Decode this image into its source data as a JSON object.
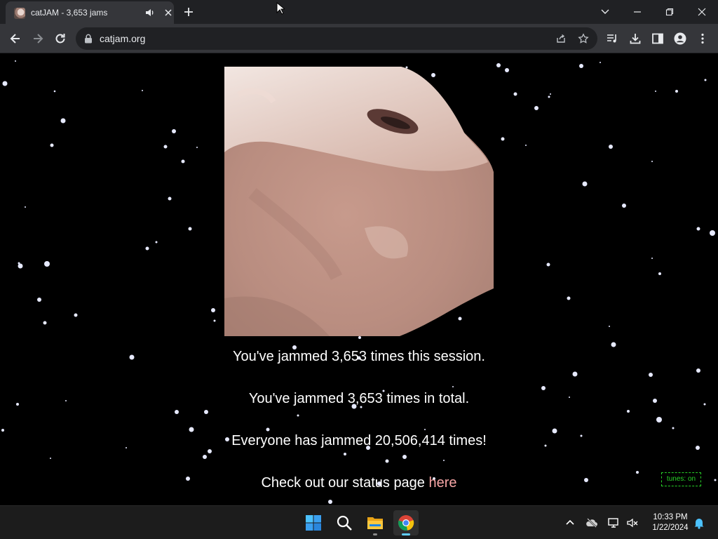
{
  "browser": {
    "tab": {
      "title": "catJAM - 3,653 jams"
    },
    "omnibox": {
      "url": "catjam.org"
    }
  },
  "page": {
    "stats": {
      "session": "You've jammed 3,653 times this session.",
      "total": "You've jammed 3,653 times in total.",
      "everyone": "Everyone has jammed 20,506,414 times!"
    },
    "status_text": "Check out our status page ",
    "status_link": "here",
    "tunes_toggle": "tunes: on",
    "colors": {
      "link": "#f7a6a6",
      "tunes": "#28d228",
      "background": "#000000"
    }
  },
  "taskbar": {
    "apps": [
      "start-icon",
      "search-icon",
      "file-explorer-icon",
      "chrome-icon"
    ],
    "clock": {
      "time": "10:33 PM",
      "date": "1/22/2024"
    }
  }
}
